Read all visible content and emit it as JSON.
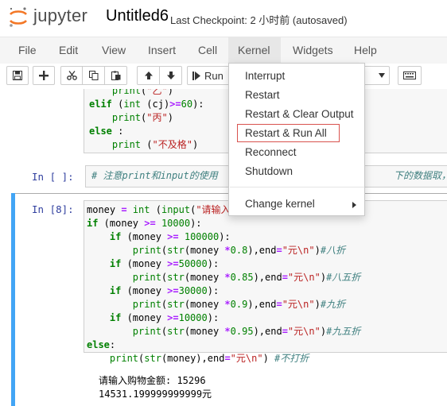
{
  "header": {
    "brand": "jupyter",
    "notebook_title": "Untitled6",
    "checkpoint": "Last Checkpoint: 2 小时前  (autosaved)"
  },
  "menubar": {
    "items": [
      "File",
      "Edit",
      "View",
      "Insert",
      "Cell",
      "Kernel",
      "Widgets",
      "Help"
    ],
    "active": "Kernel"
  },
  "toolbar": {
    "run_label": "Run"
  },
  "kernel_menu": {
    "items": [
      "Interrupt",
      "Restart",
      "Restart & Clear Output",
      "Restart & Run All",
      "Reconnect",
      "Shutdown",
      "Change kernel"
    ],
    "highlighted": "Restart & Run All"
  },
  "cells": {
    "cell1": {
      "lines": [
        "    print(\"乙\")",
        "elif (int (cj)>=60):",
        "    print(\"丙\")",
        "else :",
        "    print (\"不及格\")"
      ]
    },
    "cell2": {
      "prompt": "In  [  ]:",
      "comment": "# 注意print和input的使用",
      "comment_tail": "下的数据取，不用"
    },
    "cell3": {
      "prompt": "In  [8]:",
      "output_lines": [
        "请输入购物金额: 15296",
        "14531.199999999999元"
      ]
    }
  },
  "colors": {
    "menu_active_bg": "#e7e7e7",
    "selected_cell_bar": "#42a5f5",
    "highlight_border": "#d9534f",
    "prompt_in": "#303f9f"
  }
}
